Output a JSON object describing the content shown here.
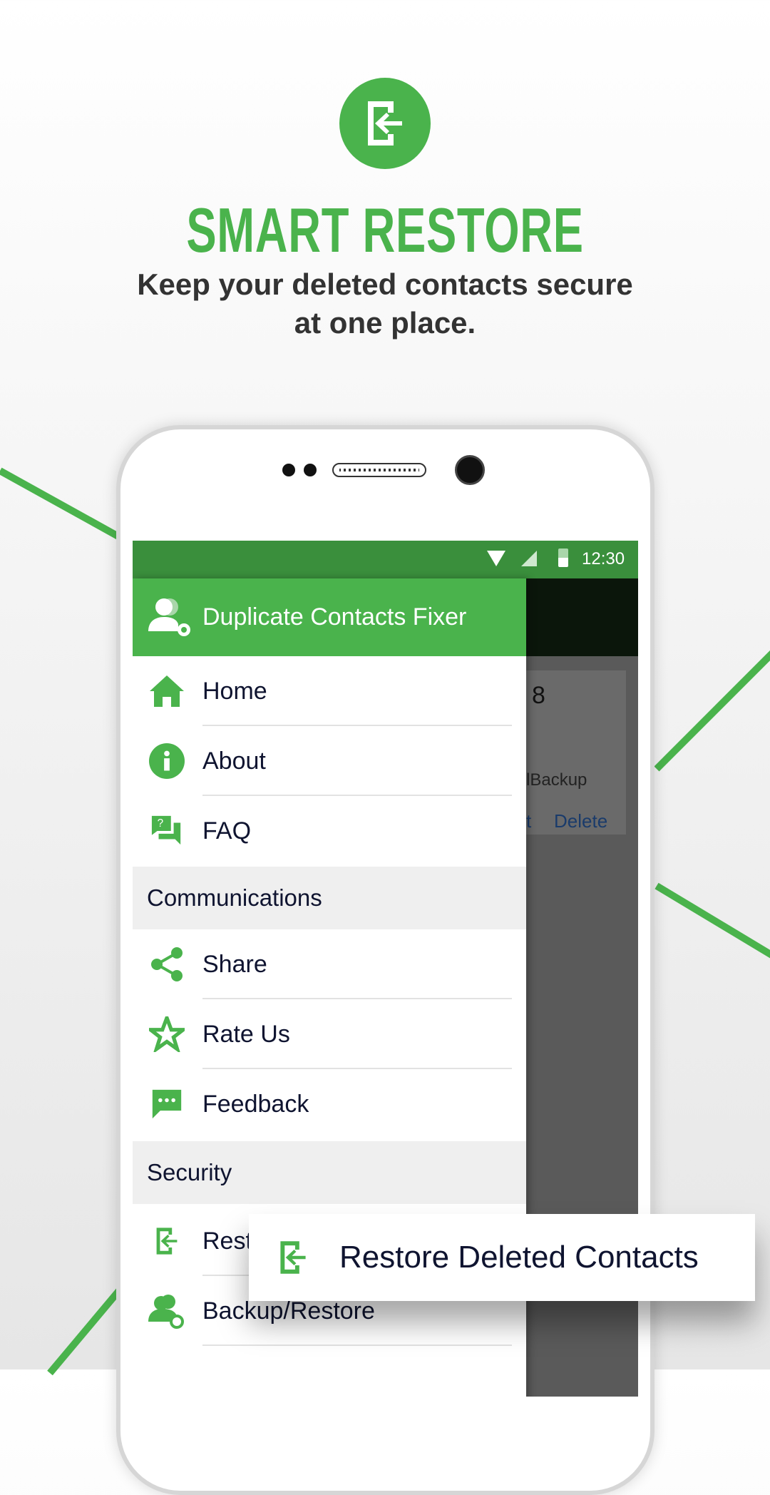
{
  "hero": {
    "icon": "restore-icon",
    "title": "SMART RESTORE",
    "subtitle_line1": "Keep your deleted contacts secure",
    "subtitle_line2": "at one place."
  },
  "colors": {
    "accent": "#4ab34c",
    "status_bar": "#3a8f3c",
    "text": "#0f1430"
  },
  "status_bar": {
    "time": "12:30",
    "icons": [
      "wifi-icon",
      "signal-icon",
      "battery-icon"
    ]
  },
  "drawer": {
    "header": "Duplicate Contacts Fixer",
    "items": [
      {
        "label": "Home",
        "icon": "home-icon"
      },
      {
        "label": "About",
        "icon": "info-icon"
      },
      {
        "label": "FAQ",
        "icon": "faq-icon"
      }
    ],
    "section1": "Communications",
    "items2": [
      {
        "label": "Share",
        "icon": "share-icon"
      },
      {
        "label": "Rate Us",
        "icon": "star-icon"
      },
      {
        "label": "Feedback",
        "icon": "feedback-icon"
      }
    ],
    "section2": "Security",
    "items3": [
      {
        "label": "Rest",
        "icon": "restore-icon"
      },
      {
        "label": "Backup/Restore",
        "icon": "backup-icon"
      }
    ]
  },
  "background_screen": {
    "count": "8",
    "label": "lBackup",
    "action1": "t",
    "action2": "Delete"
  },
  "callout": {
    "label": "Restore Deleted Contacts",
    "icon": "restore-icon"
  }
}
